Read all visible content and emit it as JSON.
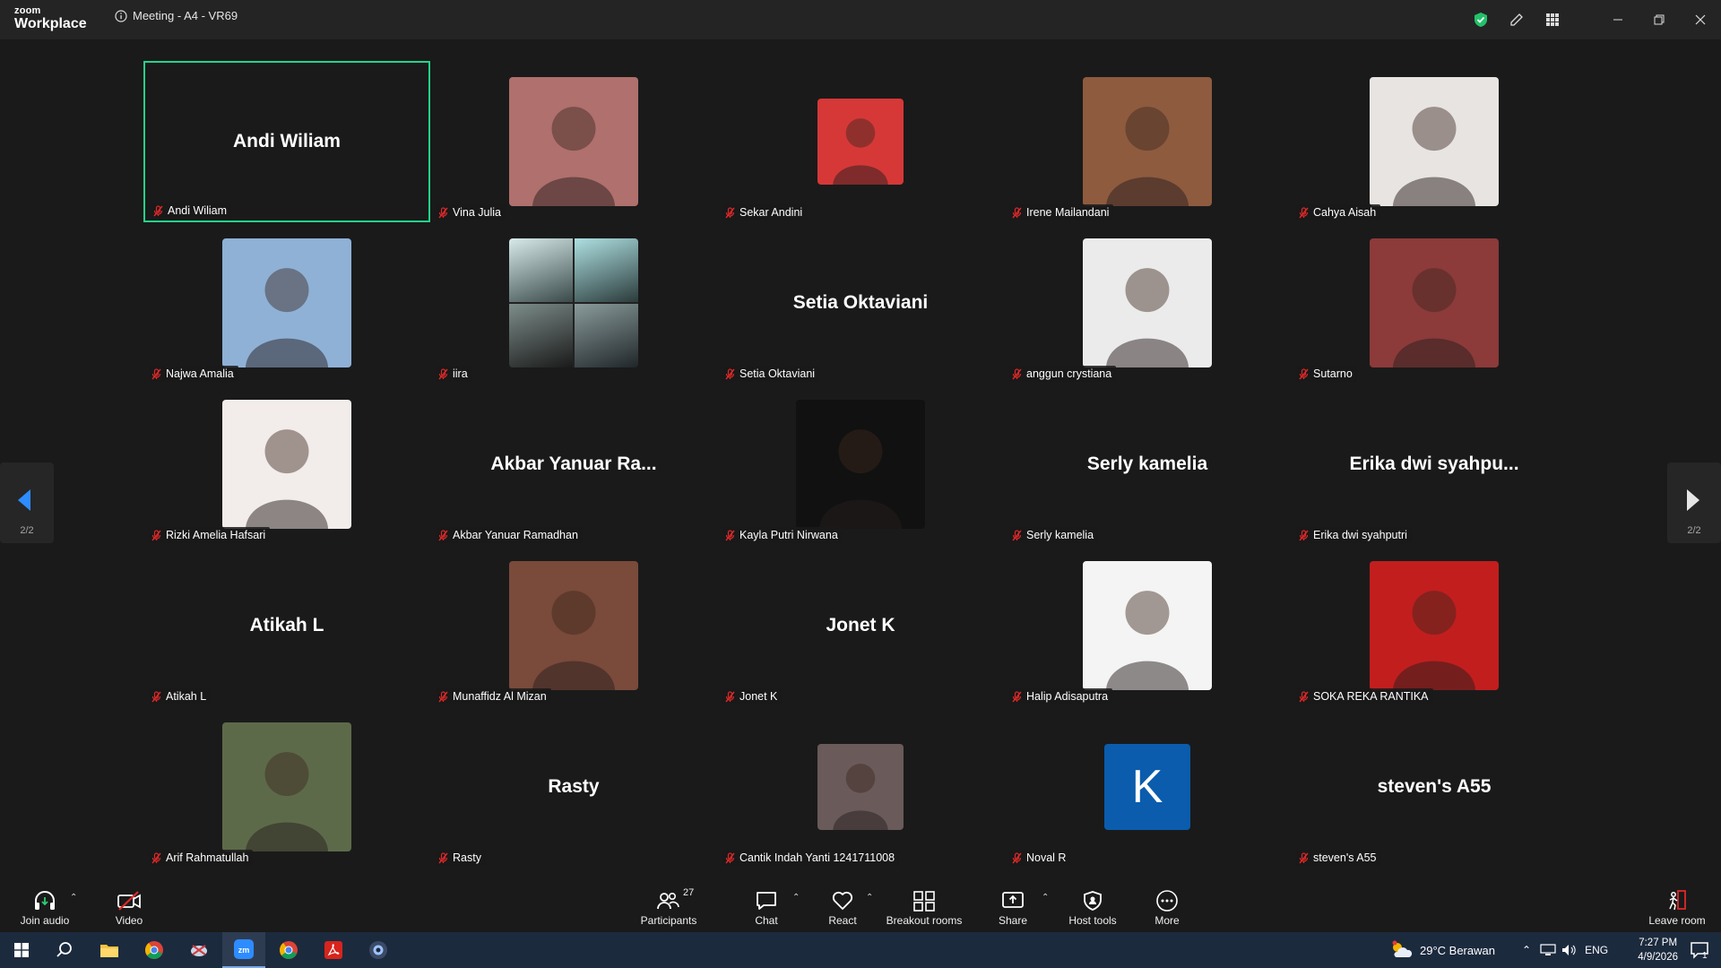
{
  "app": {
    "logo_top": "zoom",
    "logo_bottom": "Workplace",
    "meeting_title": "Meeting - A4 - VR69"
  },
  "gallery": {
    "page_indicator": "2/2",
    "tiles": [
      {
        "name": "Andi Wiliam",
        "display": "Andi Wiliam",
        "avatar": "none",
        "active": true
      },
      {
        "name": "Vina Julia",
        "display": "",
        "avatar": "photo",
        "bg": "#b0706d"
      },
      {
        "name": "Sekar Andini",
        "display": "",
        "avatar": "photo-small",
        "bg": "#d63838"
      },
      {
        "name": "Irene Mailandani",
        "display": "",
        "avatar": "photo",
        "bg": "#8e5b3f"
      },
      {
        "name": "Cahya Aisah",
        "display": "",
        "avatar": "photo",
        "bg": "#e8e4e2"
      },
      {
        "name": "Najwa Amalia",
        "display": "",
        "avatar": "photo",
        "bg": "#8fb1d6"
      },
      {
        "name": "iira",
        "display": "",
        "avatar": "photo-grid",
        "bg": "#4a6a6e"
      },
      {
        "name": "Setia Oktaviani",
        "display": "Setia Oktaviani",
        "avatar": "none"
      },
      {
        "name": "anggun crystiana",
        "display": "",
        "avatar": "photo",
        "bg": "#ecebeb"
      },
      {
        "name": "Sutarno",
        "display": "",
        "avatar": "photo",
        "bg": "#8c3a3a"
      },
      {
        "name": "Rizki Amelia Hafsari",
        "display": "",
        "avatar": "photo",
        "bg": "#f2ecea"
      },
      {
        "name": "Akbar Yanuar Ramadhan",
        "display": "Akbar Yanuar Ra...",
        "avatar": "none"
      },
      {
        "name": "Kayla Putri Nirwana",
        "display": "",
        "avatar": "photo",
        "bg": "#111111"
      },
      {
        "name": "Serly kamelia",
        "display": "Serly kamelia",
        "avatar": "none"
      },
      {
        "name": "Erika dwi syahputri",
        "display": "Erika dwi syahpu...",
        "avatar": "none"
      },
      {
        "name": "Atikah L",
        "display": "Atikah L",
        "avatar": "none"
      },
      {
        "name": "Munaffidz Al Mizan",
        "display": "",
        "avatar": "photo",
        "bg": "#7a4a3a"
      },
      {
        "name": "Jonet K",
        "display": "Jonet K",
        "avatar": "none"
      },
      {
        "name": "Halip Adisaputra",
        "display": "",
        "avatar": "photo",
        "bg": "#f4f4f4"
      },
      {
        "name": "SOKA REKA RANTIKA",
        "display": "",
        "avatar": "photo",
        "bg": "#c21e1e"
      },
      {
        "name": "Arif Rahmatullah",
        "display": "",
        "avatar": "photo",
        "bg": "#5d6a4a"
      },
      {
        "name": "Rasty",
        "display": "Rasty",
        "avatar": "none"
      },
      {
        "name": "Cantik Indah Yanti 1241711008",
        "display": "",
        "avatar": "photo-small",
        "bg": "#6a5a5a"
      },
      {
        "name": "Noval R",
        "display": "",
        "avatar": "letter",
        "letter": "K",
        "bg": "#0b5cad"
      },
      {
        "name": "steven's A55",
        "display": "steven's A55",
        "avatar": "none"
      }
    ]
  },
  "toolbar": {
    "join_audio": "Join audio",
    "video": "Video",
    "participants": "Participants",
    "participants_count": "27",
    "chat": "Chat",
    "react": "React",
    "breakout_rooms": "Breakout rooms",
    "share": "Share",
    "host_tools": "Host tools",
    "more": "More",
    "leave_room": "Leave room"
  },
  "taskbar": {
    "weather": "29°C  Berawan",
    "lang": "ENG",
    "time": "7:27 PM",
    "date": "4/9/2026",
    "notif_count": "1"
  },
  "colors": {
    "active_border": "#22d38a",
    "mute_icon": "#e02828",
    "accent": "#0e72ed"
  }
}
